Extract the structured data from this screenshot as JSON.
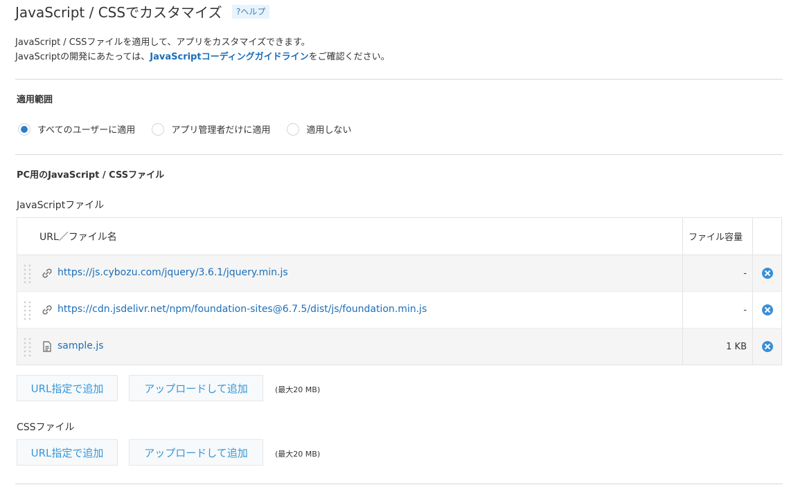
{
  "header": {
    "title": "JavaScript / CSSでカスタマイズ",
    "help": "?ヘルプ"
  },
  "description": {
    "line1": "JavaScript / CSSファイルを適用して、アプリをカスタマイズできます。",
    "line2_pre": "JavaScriptの開発にあたっては、",
    "line2_link": "JavaScriptコーディングガイドライン",
    "line2_post": "をご確認ください。"
  },
  "scope": {
    "title": "適用範囲",
    "options": [
      {
        "label": "すべてのユーザーに適用",
        "checked": true
      },
      {
        "label": "アプリ管理者だけに適用",
        "checked": false
      },
      {
        "label": "適用しない",
        "checked": false
      }
    ]
  },
  "pc_section": {
    "title": "PC用のJavaScript / CSSファイル",
    "js_label": "JavaScriptファイル",
    "css_label": "CSSファイル"
  },
  "table": {
    "col_name": "URL／ファイル名",
    "col_size": "ファイル容量",
    "rows": [
      {
        "name": "https://js.cybozu.com/jquery/3.6.1/jquery.min.js",
        "size": "-",
        "icon": "link-icon"
      },
      {
        "name": "https://cdn.jsdelivr.net/npm/foundation-sites@6.7.5/dist/js/foundation.min.js",
        "size": "-",
        "icon": "link-icon"
      },
      {
        "name": "sample.js",
        "size": "1 KB",
        "icon": "file-icon"
      }
    ]
  },
  "buttons": {
    "add_url": "URL指定で追加",
    "upload": "アップロードして追加",
    "max_note": "(最大20 MB)"
  },
  "colors": {
    "accent": "#3498db",
    "link": "#1a6eb8",
    "delete": "#3b8ed6"
  }
}
